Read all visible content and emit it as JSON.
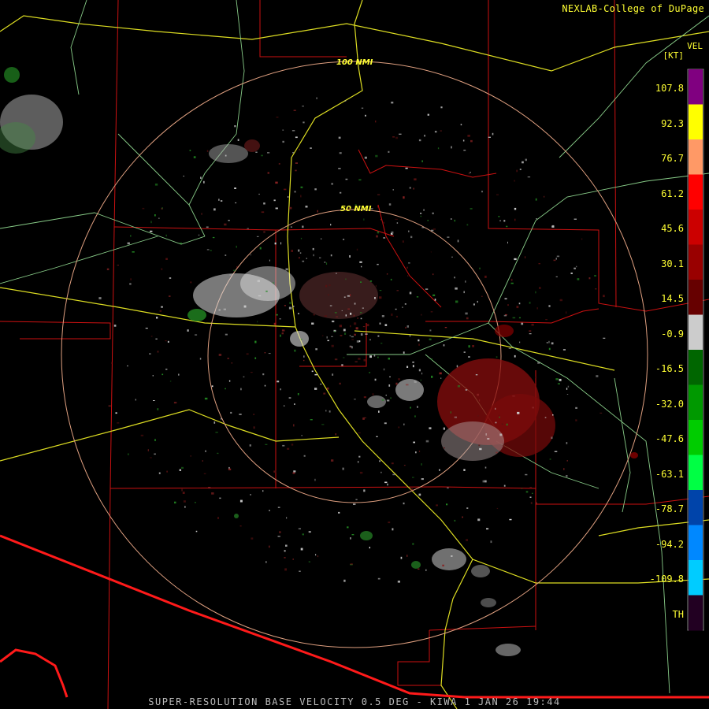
{
  "header": {
    "credit": "NEXLAB-College of DuPage"
  },
  "legend": {
    "product": "VEL",
    "unit": "[KT]",
    "labels": [
      "107.8",
      "92.3",
      "76.7",
      "61.2",
      "45.6",
      "30.1",
      "14.5",
      "-0.9",
      "-16.5",
      "-32.0",
      "-47.6",
      "-63.1",
      "-78.7",
      "-94.2",
      "-109.8",
      "TH"
    ],
    "colors": [
      "#800080",
      "#ffff00",
      "#ff9966",
      "#ff0000",
      "#cc0000",
      "#990000",
      "#660000",
      "#cccccc",
      "#006600",
      "#009900",
      "#00cc00",
      "#00ff44",
      "#0044aa",
      "#0088ff",
      "#00ccff",
      "#220022"
    ]
  },
  "map": {
    "range_rings": [
      {
        "label": "100 NMI"
      },
      {
        "label": "50 NMI"
      }
    ]
  },
  "footer": {
    "caption": "SUPER-RESOLUTION BASE VELOCITY 0.5 DEG - KIWA 1 JAN 26 19:44"
  }
}
